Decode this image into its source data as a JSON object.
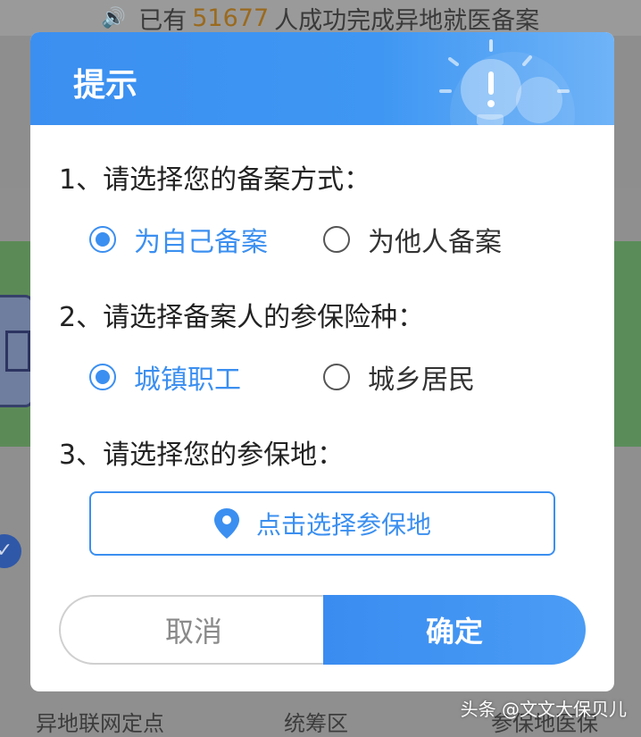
{
  "background": {
    "banner": {
      "prefix": "已有",
      "count": "51677",
      "suffix": "人成功完成异地就医备案"
    },
    "menu_items": [
      "异地联网定点",
      "统筹区",
      "参保地医保"
    ]
  },
  "watermark": "头条 @文文大保贝儿",
  "dialog": {
    "title": "提示",
    "question1": "1、请选择您的备案方式：",
    "filing_options": [
      {
        "label": "为自己备案",
        "selected": true
      },
      {
        "label": "为他人备案",
        "selected": false
      }
    ],
    "question2": "2、请选择备案人的参保险种：",
    "insurance_options": [
      {
        "label": "城镇职工",
        "selected": true
      },
      {
        "label": "城乡居民",
        "selected": false
      }
    ],
    "question3": "3、请选择您的参保地：",
    "location_button": "点击选择参保地",
    "cancel_label": "取消",
    "confirm_label": "确定"
  },
  "colors": {
    "accent": "#3b8ff0",
    "header": "#3f97f3",
    "text": "#222222",
    "muted": "#8a8a8a"
  },
  "icons": [
    "speaker-icon",
    "lightbulb-icon",
    "location-pin-icon",
    "radio-checked-icon",
    "radio-unchecked-icon"
  ]
}
